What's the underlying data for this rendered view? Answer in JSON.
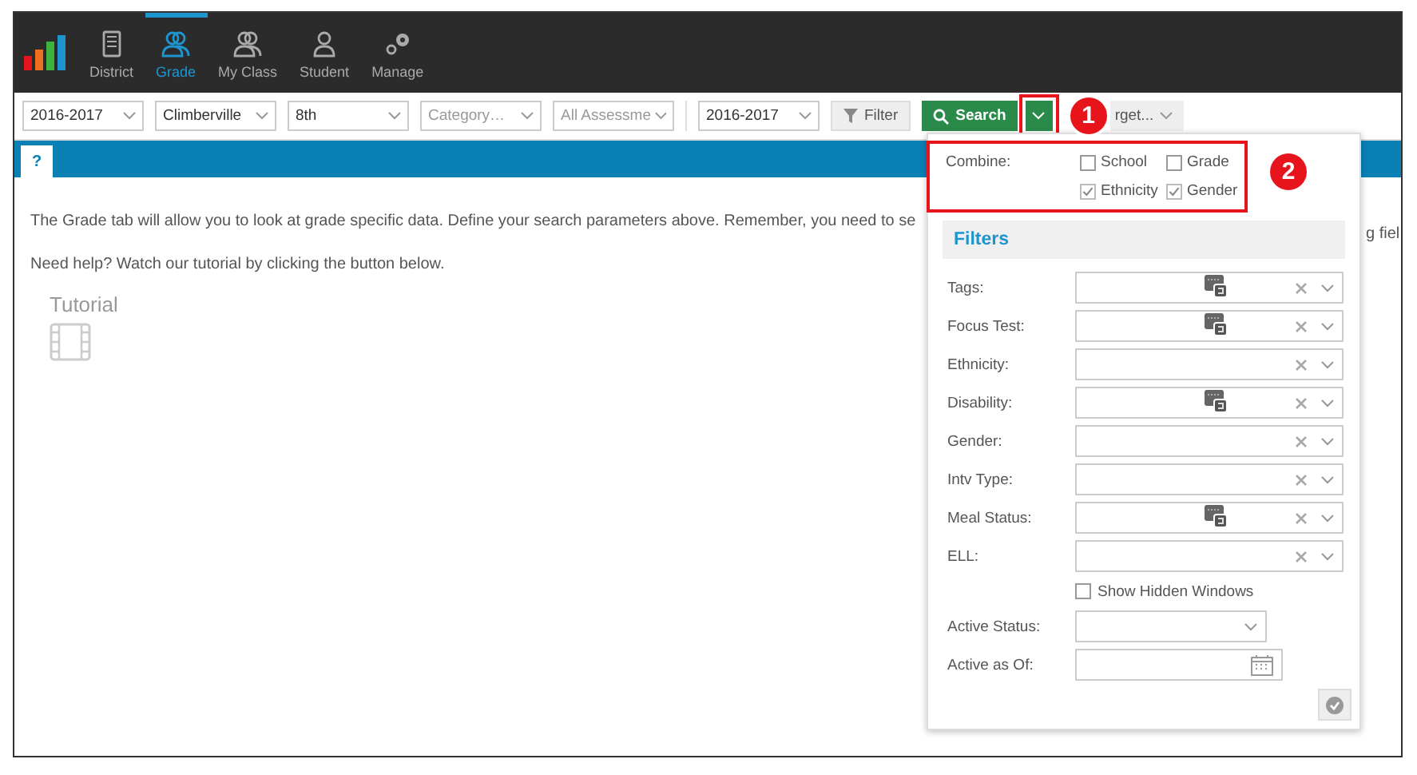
{
  "nav": {
    "items": [
      {
        "label": "District",
        "kind": "tablet",
        "selected": false
      },
      {
        "label": "Grade",
        "kind": "group",
        "selected": true
      },
      {
        "label": "My Class",
        "kind": "group",
        "selected": false
      },
      {
        "label": "Student",
        "kind": "person",
        "selected": false
      },
      {
        "label": "Manage",
        "kind": "gears",
        "selected": false
      }
    ]
  },
  "toolbar": {
    "dropdowns": [
      {
        "value": "2016-2017"
      },
      {
        "value": "Climberville"
      },
      {
        "value": "8th"
      },
      {
        "placeholder": "Category…"
      },
      {
        "placeholder": "All Assessme"
      },
      {
        "value": "2016-2017"
      }
    ],
    "filter_button": "Filter",
    "search_button": "Search",
    "target_button": "rget..."
  },
  "help_tab": "?",
  "content": {
    "intro": "The Grade tab will allow you to look at grade specific data. Define your search parameters above. Remember, you need to se",
    "intro_overflow": "g fiel",
    "help": "Need help? Watch our tutorial by clicking the button below.",
    "tutorial": "Tutorial"
  },
  "popup": {
    "combine_label": "Combine:",
    "options": [
      {
        "label": "School",
        "checked": false
      },
      {
        "label": "Grade",
        "checked": false
      },
      {
        "label": "Ethnicity",
        "checked": true
      },
      {
        "label": "Gender",
        "checked": true
      }
    ],
    "filters_title": "Filters",
    "filters": [
      {
        "label": "Tags:",
        "kind": "multi"
      },
      {
        "label": "Focus Test:",
        "kind": "multi"
      },
      {
        "label": "Ethnicity:",
        "kind": "select"
      },
      {
        "label": "Disability:",
        "kind": "multi"
      },
      {
        "label": "Gender:",
        "kind": "select"
      },
      {
        "label": "Intv Type:",
        "kind": "select"
      },
      {
        "label": "Meal Status:",
        "kind": "multi"
      },
      {
        "label": "ELL:",
        "kind": "select"
      }
    ],
    "show_hidden": {
      "label": "Show Hidden Windows",
      "checked": false
    },
    "active_status": "Active Status:",
    "active_as_of": "Active as Of:"
  },
  "annotations": [
    {
      "label": "1"
    },
    {
      "label": "2"
    }
  ]
}
